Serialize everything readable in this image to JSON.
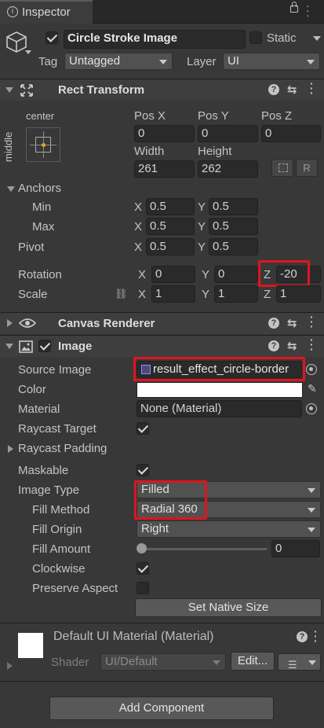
{
  "tab": {
    "label": "Inspector"
  },
  "object": {
    "name": "Circle Stroke Image",
    "static_label": "Static",
    "tag_label": "Tag",
    "tag_value": "Untagged",
    "layer_label": "Layer",
    "layer_value": "UI"
  },
  "rect": {
    "title": "Rect Transform",
    "anchor_h": "center",
    "anchor_v": "middle",
    "posx_label": "Pos X",
    "posy_label": "Pos Y",
    "posz_label": "Pos Z",
    "posx": "0",
    "posy": "0",
    "posz": "0",
    "width_label": "Width",
    "height_label": "Height",
    "width": "261",
    "height": "262",
    "r_label": "R",
    "anchors_label": "Anchors",
    "min_label": "Min",
    "max_label": "Max",
    "pivot_label": "Pivot",
    "min_x": "0.5",
    "min_y": "0.5",
    "max_x": "0.5",
    "max_y": "0.5",
    "pivot_x": "0.5",
    "pivot_y": "0.5",
    "rotation_label": "Rotation",
    "rot_x": "0",
    "rot_y": "0",
    "rot_z": "-20",
    "scale_label": "Scale",
    "scale_x": "1",
    "scale_y": "1",
    "scale_z": "1",
    "x": "X",
    "y": "Y",
    "z": "Z"
  },
  "canvas_renderer": {
    "title": "Canvas Renderer"
  },
  "image": {
    "title": "Image",
    "source_label": "Source Image",
    "source_value": "result_effect_circle-border",
    "color_label": "Color",
    "color_value": "#ffffff",
    "material_label": "Material",
    "material_value": "None (Material)",
    "raycast_target_label": "Raycast Target",
    "raycast_padding_label": "Raycast Padding",
    "maskable_label": "Maskable",
    "image_type_label": "Image Type",
    "image_type_value": "Filled",
    "fill_method_label": "Fill Method",
    "fill_method_value": "Radial 360",
    "fill_origin_label": "Fill Origin",
    "fill_origin_value": "Right",
    "fill_amount_label": "Fill Amount",
    "fill_amount_value": "0",
    "fill_amount": 0,
    "clockwise_label": "Clockwise",
    "preserve_label": "Preserve Aspect",
    "native_size_label": "Set Native Size"
  },
  "material": {
    "name": "Default UI Material (Material)",
    "shader_label": "Shader",
    "shader_value": "UI/Default",
    "edit_label": "Edit..."
  },
  "add_component_label": "Add Component",
  "colors": {
    "highlight": "#e0141e",
    "background": "#383838"
  }
}
